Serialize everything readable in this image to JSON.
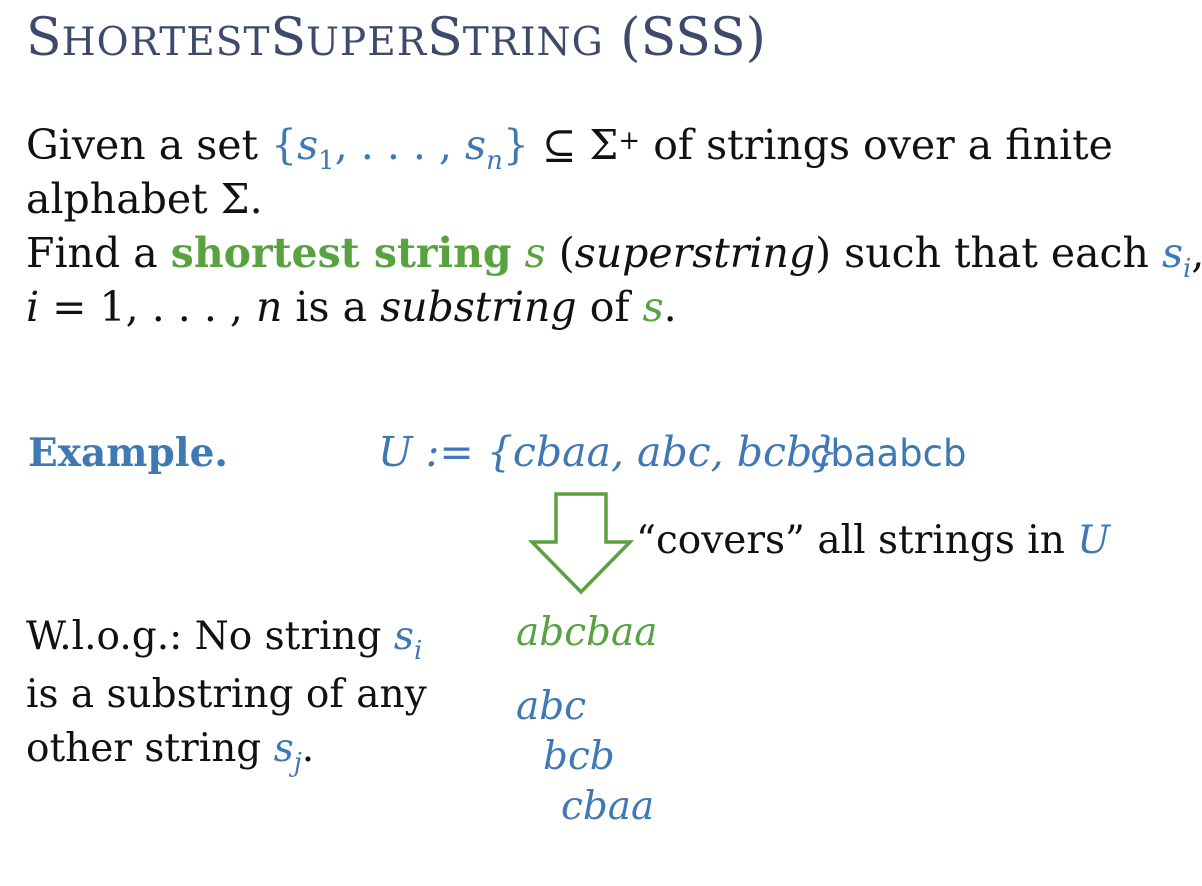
{
  "title": {
    "first_s": "S",
    "hortest": "HORTEST",
    "s2": "S",
    "uper": "UPER",
    "s3": "S",
    "tring": "TRING",
    "abbr": "(SSS)"
  },
  "definition": {
    "line1_a": "Given a set ",
    "set_open": "{",
    "s1": "s",
    "s1_sub": "1",
    "ellipsis": ", . . . , ",
    "sn": "s",
    "sn_sub": "n",
    "set_close": "}",
    "subseteq": " ⊆ Σ",
    "plus": "+",
    "line1_b": " of strings over a finite",
    "line2": "alphabet Σ.",
    "line3_a": "Find a ",
    "shortest_string": "shortest string",
    "s_var": "s",
    "paren_open": " (",
    "superstring": "superstring",
    "line3_b": ") such that each ",
    "si": "s",
    "si_sub": "i",
    "comma": ",",
    "line4_i": "i",
    "line4_a": " = 1, . . . , ",
    "line4_n": "n",
    "line4_b": " is a ",
    "substring": "substring",
    "line4_c": " of ",
    "line4_s": "s",
    "period": "."
  },
  "example": {
    "label": "Example.",
    "set_text": "U := {cbaa, abc, bcb}",
    "superstring_plain": "cbaabcb",
    "covers_text": "“covers” all strings in ",
    "covers_U": "U",
    "result": "abcbaa",
    "aligned": [
      "abc",
      "bcb",
      "cbaa"
    ]
  },
  "wlog": {
    "line1": "W.l.o.g.: No string ",
    "si": "s",
    "si_sub": "i",
    "line2": "is a substring of any",
    "line3": "other string ",
    "sj": "s",
    "sj_sub": "j",
    "period": "."
  },
  "colors": {
    "title": "#3e4a6b",
    "blue": "#3f79b4",
    "green": "#58a23f",
    "text": "#111111"
  }
}
